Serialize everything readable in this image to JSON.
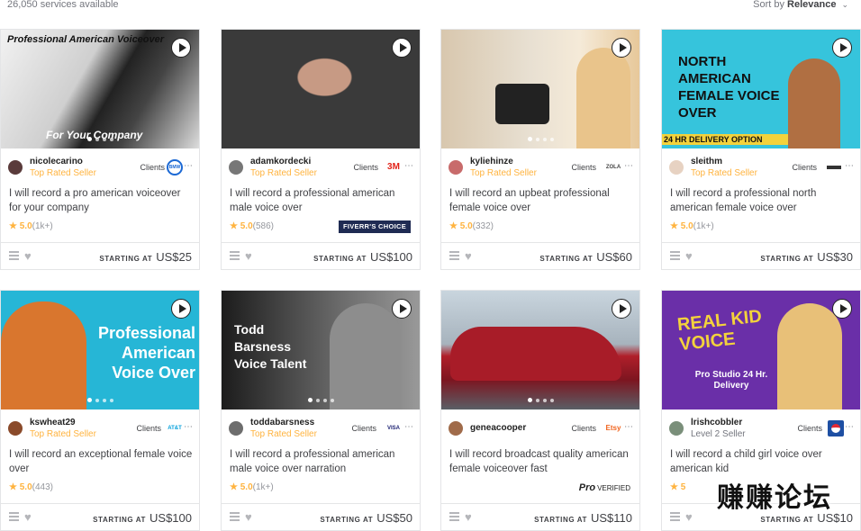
{
  "header": {
    "count": "26,050 services available",
    "sort_prefix": "Sort by ",
    "sort_value": "Relevance"
  },
  "cards": [
    {
      "seller": "nicolecarino",
      "level": "Top Rated Seller",
      "clients": "Clients",
      "client_logo": "BMW",
      "title": "I will record a pro american voiceover for your company",
      "rating": "5.0",
      "rating_count": "(1k+)",
      "price_label": "STARTING AT",
      "price": "US$25",
      "thumb_text_1": "Professional American Voiceover",
      "thumb_text_2": "For Your Company"
    },
    {
      "seller": "adamkordecki",
      "level": "Top Rated Seller",
      "clients": "Clients",
      "client_logo": "3M",
      "title": "I will record a professional american male voice over",
      "rating": "5.0",
      "rating_count": "(586)",
      "badge": "FIVERR'S CHOICE",
      "price_label": "STARTING AT",
      "price": "US$100"
    },
    {
      "seller": "kyliehinze",
      "level": "Top Rated Seller",
      "clients": "Clients",
      "client_logo": "ZOLA",
      "title": "I will record an upbeat professional female voice over",
      "rating": "5.0",
      "rating_count": "(332)",
      "price_label": "STARTING AT",
      "price": "US$60"
    },
    {
      "seller": "sleithm",
      "level": "Top Rated Seller",
      "clients": "Clients",
      "client_logo": "logo",
      "title": "I will record a professional north american female voice over",
      "rating": "5.0",
      "rating_count": "(1k+)",
      "price_label": "STARTING AT",
      "price": "US$30",
      "thumb_text_1": "NORTH AMERICAN FEMALE VOICE OVER",
      "thumb_text_2": "24 HR DELIVERY OPTION"
    },
    {
      "seller": "kswheat29",
      "level": "Top Rated Seller",
      "clients": "Clients",
      "client_logo": "AT&T",
      "title": "I will record an exceptional female voice over",
      "rating": "5.0",
      "rating_count": "(443)",
      "price_label": "STARTING AT",
      "price": "US$100",
      "thumb_text_1": "Professional American Voice Over"
    },
    {
      "seller": "toddabarsness",
      "level": "Top Rated Seller",
      "clients": "Clients",
      "client_logo": "VISA",
      "title": "I will record a professional american male voice over narration",
      "rating": "5.0",
      "rating_count": "(1k+)",
      "price_label": "STARTING AT",
      "price": "US$50",
      "thumb_text_1": "Todd Barsness Voice Talent"
    },
    {
      "seller": "geneacooper",
      "level": "",
      "clients": "Clients",
      "client_logo": "Etsy",
      "title": "I will record broadcast quality american female voiceover fast",
      "pro_label": "Pro",
      "pro_verified": "VERIFIED",
      "price_label": "STARTING AT",
      "price": "US$110"
    },
    {
      "seller": "lrishcobbler",
      "level": "Level 2 Seller",
      "clients": "Clients",
      "client_logo": "pepsi",
      "title": "I will record a child girl voice over american kid",
      "rating": "5",
      "price_label": "STARTING AT",
      "price": "US$10",
      "thumb_text_1": "REAL KID VOICE",
      "thumb_text_2": "Pro Studio 24 Hr. Delivery"
    }
  ],
  "watermark": "赚赚论坛",
  "colors": {
    "star": "#ffb33e",
    "top_rated": "#ffb33e",
    "badge_bg": "#1f2b53"
  }
}
